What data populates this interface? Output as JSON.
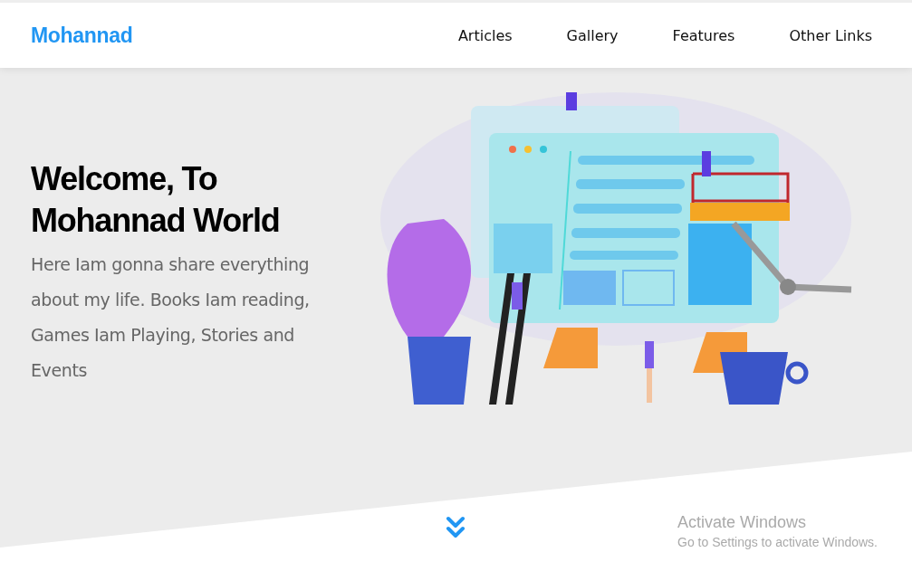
{
  "header": {
    "logo": "Mohannad",
    "nav": [
      {
        "label": "Articles"
      },
      {
        "label": "Gallery"
      },
      {
        "label": "Features"
      },
      {
        "label": "Other Links"
      }
    ]
  },
  "hero": {
    "title_lines": [
      "Welcome, To",
      "Mohannad World"
    ],
    "text": "Here Iam gonna share everything about my life. Books Iam reading, Games Iam Playing, Stories and Events"
  },
  "os_notice": {
    "title": "Activate Windows",
    "text": "Go to Settings to activate Windows."
  }
}
